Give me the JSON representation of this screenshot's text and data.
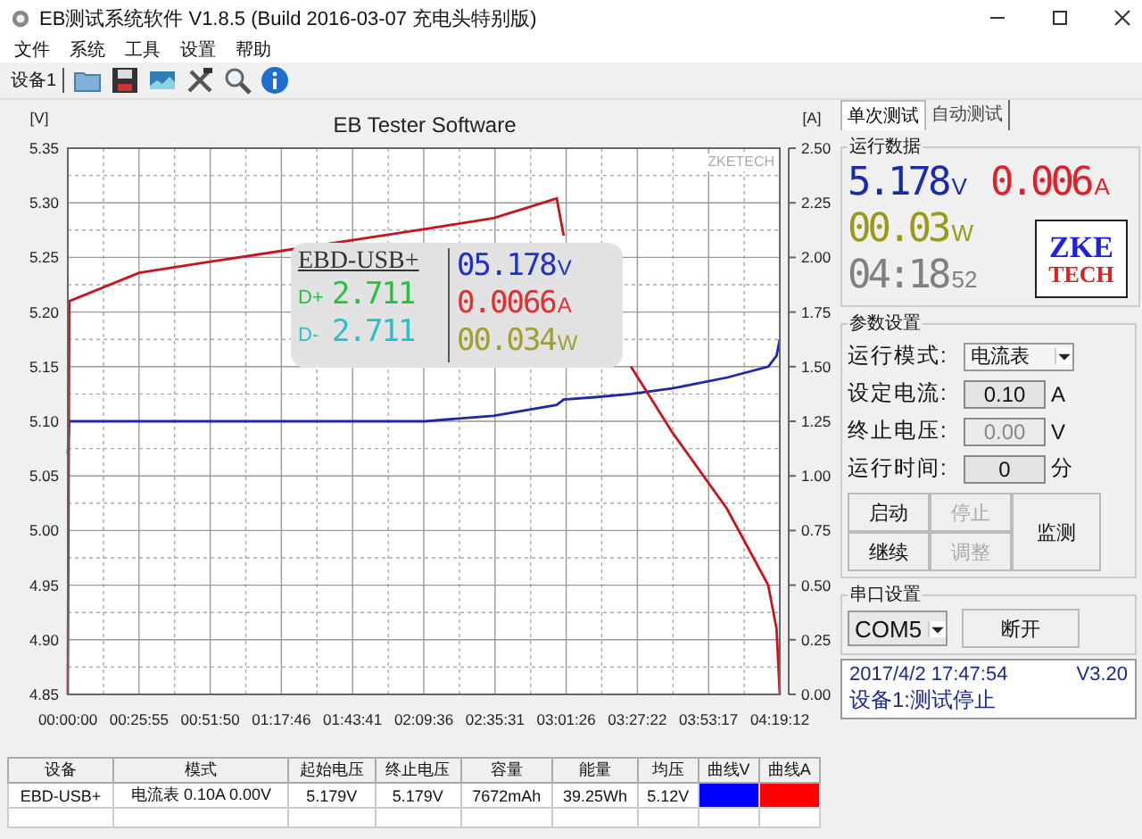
{
  "window": {
    "title": "EB测试系统软件 V1.8.5 (Build 2016-03-07 充电头特别版)"
  },
  "menu": [
    "文件",
    "系统",
    "工具",
    "设置",
    "帮助"
  ],
  "toolbar": {
    "device_label": "设备1",
    "tools": [
      {
        "kind": "folder"
      },
      {
        "kind": "save"
      },
      {
        "kind": "image"
      },
      {
        "kind": "tools"
      },
      {
        "kind": "search"
      },
      {
        "kind": "info"
      }
    ]
  },
  "chart": {
    "watermark": "ZKETECH",
    "chart_data": {
      "type": "line",
      "title": "EB Tester Software",
      "ylabel": "[V]",
      "y2label": "[A]",
      "grid": true,
      "x": [
        0,
        0.5,
        26,
        52,
        78,
        104,
        130,
        155,
        178,
        180.5,
        192,
        205,
        220,
        240,
        255,
        258,
        259.2
      ],
      "xlim": [
        0,
        259.2
      ],
      "xticks": [
        {
          "value": 0,
          "label": "00:00:00"
        },
        {
          "value": 25.92,
          "label": "00:25:55"
        },
        {
          "value": 51.84,
          "label": "00:51:50"
        },
        {
          "value": 77.76,
          "label": "01:17:46"
        },
        {
          "value": 103.68,
          "label": "01:43:41"
        },
        {
          "value": 129.6,
          "label": "02:09:36"
        },
        {
          "value": 155.52,
          "label": "02:35:31"
        },
        {
          "value": 181.44,
          "label": "03:01:26"
        },
        {
          "value": 207.36,
          "label": "03:27:22"
        },
        {
          "value": 233.28,
          "label": "03:53:17"
        },
        {
          "value": 259.2,
          "label": "04:19:12"
        }
      ],
      "ylim": [
        4.85,
        5.35
      ],
      "yticks": [
        {
          "value": 4.85,
          "label": "4.85"
        },
        {
          "value": 4.9,
          "label": "4.90"
        },
        {
          "value": 4.95,
          "label": "4.95"
        },
        {
          "value": 5,
          "label": "5.00"
        },
        {
          "value": 5.05,
          "label": "5.05"
        },
        {
          "value": 5.1,
          "label": "5.10"
        },
        {
          "value": 5.15,
          "label": "5.15"
        },
        {
          "value": 5.2,
          "label": "5.20"
        },
        {
          "value": 5.25,
          "label": "5.25"
        },
        {
          "value": 5.3,
          "label": "5.30"
        },
        {
          "value": 5.35,
          "label": "5.35"
        }
      ],
      "y2lim": [
        0,
        2.5
      ],
      "y2ticks": [
        {
          "value": 0,
          "label": "0.00"
        },
        {
          "value": 0.25,
          "label": "0.25"
        },
        {
          "value": 0.5,
          "label": "0.50"
        },
        {
          "value": 0.75,
          "label": "0.75"
        },
        {
          "value": 1,
          "label": "1.00"
        },
        {
          "value": 1.25,
          "label": "1.25"
        },
        {
          "value": 1.5,
          "label": "1.50"
        },
        {
          "value": 1.75,
          "label": "1.75"
        },
        {
          "value": 2,
          "label": "2.00"
        },
        {
          "value": 2.25,
          "label": "2.25"
        },
        {
          "value": 2.5,
          "label": "2.50"
        }
      ],
      "series": [
        {
          "color": "#1c2aa8",
          "values": [
            5.07,
            5.1,
            5.1,
            5.1,
            5.1,
            5.1,
            5.1,
            5.105,
            5.115,
            5.12,
            5.122,
            5.125,
            5.13,
            5.14,
            5.15,
            5.16,
            5.175
          ]
        },
        {
          "color": "#c8141e",
          "axis": "y2",
          "values": [
            0,
            1.8,
            1.93,
            1.98,
            2.03,
            2.08,
            2.13,
            2.18,
            2.27,
            2.1,
            null,
            1.5,
            1.2,
            0.85,
            0.5,
            0.3,
            0
          ]
        }
      ]
    }
  },
  "overlay": {
    "model": "EBD-USB+",
    "lines": [
      {
        "label": "D+",
        "value": "2.711",
        "color": "#28c040"
      },
      {
        "label": "D-",
        "value": "2.711",
        "color": "#28c0c8"
      }
    ],
    "readings": [
      {
        "value": "05.178",
        "unit": "V",
        "color": "#2030d0"
      },
      {
        "value": "0.0066",
        "unit": "A",
        "color": "#e03030"
      },
      {
        "value": "00.034",
        "unit": "W",
        "color": "#a0a030"
      }
    ]
  },
  "tabs": [
    {
      "label": "单次测试",
      "selected": true
    },
    {
      "label": "自动测试",
      "selected": false
    }
  ],
  "run_data": {
    "title": "运行数据",
    "readings": [
      {
        "value": "5.178",
        "unit": "V",
        "color": "#1a2aa8"
      },
      {
        "value": "0.006",
        "unit": "A",
        "color": "#e0202a"
      },
      {
        "value": "00.03",
        "unit": "W",
        "color": "#9a9a1a"
      },
      {
        "value": "04:18",
        "unit": "52",
        "color": "#808080"
      }
    ],
    "logo": [
      "ZKE",
      "TECH"
    ]
  },
  "params": {
    "title": "参数设置",
    "mode_label": "运行模式:",
    "mode": "电流表",
    "fields": [
      {
        "label": "设定电流:",
        "value": "0.10",
        "unit": "A",
        "disabled": false
      },
      {
        "label": "终止电压:",
        "value": "0.00",
        "unit": "V",
        "disabled": true
      },
      {
        "label": "运行时间:",
        "value": "0",
        "unit": "分",
        "disabled": false
      }
    ],
    "buttons": [
      {
        "label": "启动",
        "disabled": false
      },
      {
        "label": "停止",
        "disabled": true
      },
      {
        "label": "继续",
        "disabled": false
      },
      {
        "label": "调整",
        "disabled": true
      }
    ],
    "monitor": "监测"
  },
  "serial": {
    "title": "串口设置",
    "port": "COM5",
    "button": "断开"
  },
  "status": {
    "time": "2017/4/2 17:47:54",
    "version": "V3.20",
    "message": "设备1:测试停止"
  },
  "table": {
    "columns": [
      "设备",
      "模式",
      "起始电压",
      "终止电压",
      "容量",
      "能量",
      "均压",
      "曲线V",
      "曲线A"
    ],
    "rows": [
      {
        "cells": [
          {
            "kind": "text",
            "text": "EBD-USB+"
          },
          {
            "kind": "text",
            "text": "电流表 0.10A 0.00V"
          },
          {
            "kind": "text",
            "text": "5.179V"
          },
          {
            "kind": "text",
            "text": "5.179V"
          },
          {
            "kind": "text",
            "text": "7672mAh"
          },
          {
            "kind": "text",
            "text": "39.25Wh"
          },
          {
            "kind": "text",
            "text": "5.12V"
          },
          {
            "kind": "swatch",
            "color": "#0000ff"
          },
          {
            "kind": "swatch",
            "color": "#ff0000"
          }
        ]
      }
    ]
  }
}
